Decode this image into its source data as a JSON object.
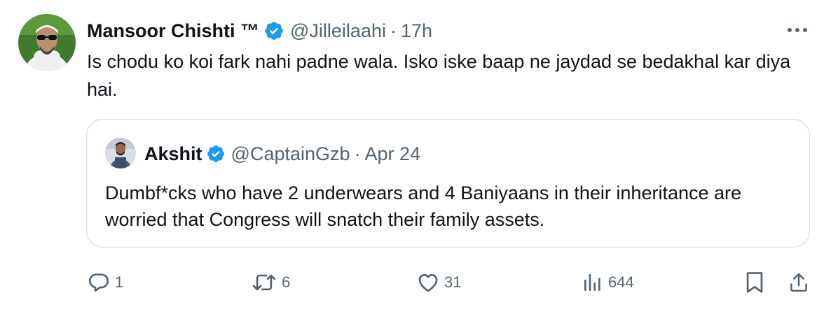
{
  "tweet": {
    "author_name": "Mansoor Chishti ™",
    "handle": "@Jilleilaahi",
    "separator": "·",
    "time": "17h",
    "text": "Is chodu ko koi fark nahi padne wala. Isko iske baap ne jaydad se bedakhal kar diya hai.",
    "avatar_icon": "profile-photo"
  },
  "quoted": {
    "author_name": "Akshit",
    "handle": "@CaptainGzb",
    "separator": "·",
    "date": "Apr 24",
    "text": "Dumbf*cks who have 2 underwears and 4 Baniyaans in their inheritance are worried that Congress will snatch their family assets.",
    "avatar_icon": "profile-photo"
  },
  "actions": {
    "replies": "1",
    "reposts": "6",
    "likes": "31",
    "views": "644"
  },
  "colors": {
    "verified": "#1d9bf0",
    "secondary_text": "#536471",
    "border": "#cfd9de",
    "primary_text": "#0f1419"
  }
}
